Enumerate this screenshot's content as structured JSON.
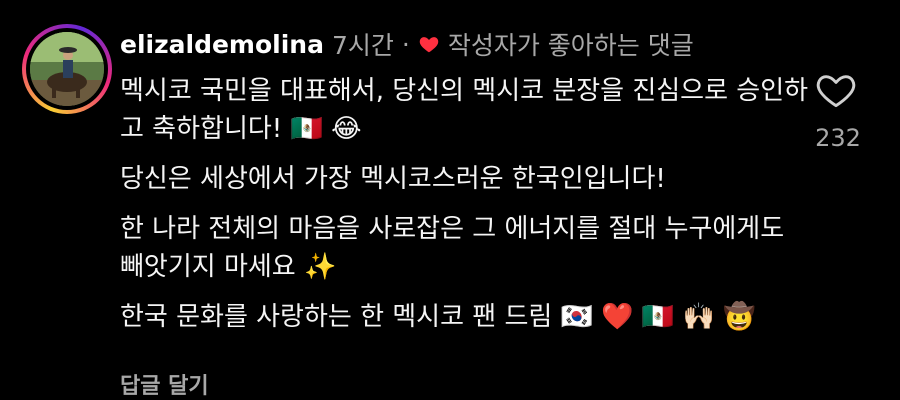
{
  "comment": {
    "username": "elizaldemolina",
    "time": "7시간",
    "separator": "·",
    "liked_by_creator_text": "작성자가 좋아하는 댓글",
    "paragraphs": [
      "멕시코 국민을 대표해서, 당신의 멕시코 분장을 진심으로 승인하고 축하합니다! 🇲🇽 😂",
      "당신은 세상에서 가장 멕시코스러운 한국인입니다!",
      "한 나라 전체의 마음을 사로잡은 그 에너지를 절대 누구에게도 빼앗기지 마세요 ✨",
      "한국 문화를 사랑하는 한 멕시코 팬 드림 🇰🇷 ❤️ 🇲🇽 🙌🏻 🤠"
    ],
    "reply_label": "답글 달기"
  },
  "like": {
    "count": "232"
  },
  "icons": {
    "avatar": "avatar-photo",
    "liked_heart": "heart-filled-icon",
    "like": "heart-outline-icon"
  },
  "colors": {
    "background": "#000000",
    "text": "#f5f5f5",
    "secondary": "#a8a8a8",
    "heart_red": "#ff3040"
  }
}
